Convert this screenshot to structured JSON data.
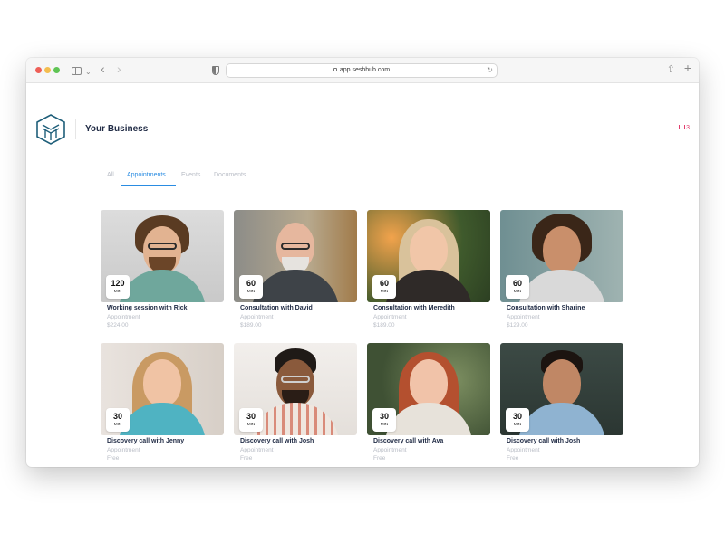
{
  "browser": {
    "url": "app.seshhub.com"
  },
  "header": {
    "business_name": "Your Business",
    "cart_count": "3"
  },
  "tabs": [
    "All",
    "Appointments",
    "Events",
    "Documents"
  ],
  "active_tab": "Appointments",
  "colors": {
    "accent": "#2a8ce2",
    "cart": "#e23d6d",
    "title_text": "#1f2a44",
    "muted_text": "#b8bcc5",
    "logo": "#1f5f7a"
  },
  "cards": [
    {
      "duration": "120",
      "unit": "MIN",
      "title": "Working session with Rick",
      "type": "Appointment",
      "price": "$224.00"
    },
    {
      "duration": "60",
      "unit": "MIN",
      "title": "Consultation with David",
      "type": "Appointment",
      "price": "$189.00"
    },
    {
      "duration": "60",
      "unit": "MIN",
      "title": "Consultation with Meredith",
      "type": "Appointment",
      "price": "$189.00"
    },
    {
      "duration": "60",
      "unit": "MIN",
      "title": "Consultation with Sharine",
      "type": "Appointment",
      "price": "$129.00"
    },
    {
      "duration": "30",
      "unit": "MIN",
      "title": "Discovery call with Jenny",
      "type": "Appointment",
      "price": "Free"
    },
    {
      "duration": "30",
      "unit": "MIN",
      "title": "Discovery call with Josh",
      "type": "Appointment",
      "price": "Free"
    },
    {
      "duration": "30",
      "unit": "MIN",
      "title": "Discovery call with Ava",
      "type": "Appointment",
      "price": "Free"
    },
    {
      "duration": "30",
      "unit": "MIN",
      "title": "Discovery call with Josh",
      "type": "Appointment",
      "price": "Free"
    }
  ]
}
